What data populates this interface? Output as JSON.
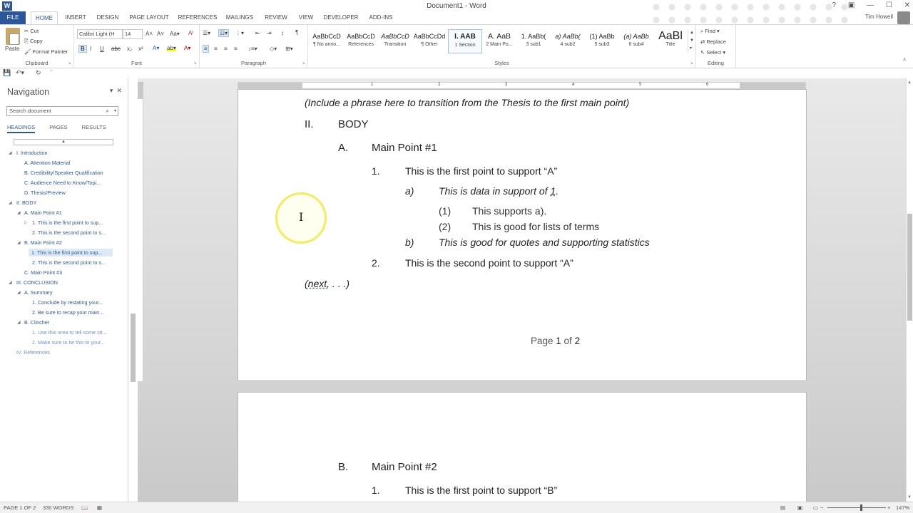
{
  "window": {
    "title": "Document1 - Word",
    "app_icon": "W",
    "user": "Tim Howell"
  },
  "tabs": [
    "FILE",
    "HOME",
    "INSERT",
    "DESIGN",
    "PAGE LAYOUT",
    "REFERENCES",
    "MAILINGS",
    "REVIEW",
    "VIEW",
    "DEVELOPER",
    "ADD-INS"
  ],
  "clipboard": {
    "paste": "Paste",
    "cut": "Cut",
    "copy": "Copy",
    "format_painter": "Format Painter",
    "label": "Clipboard"
  },
  "font": {
    "name": "Calibri Light (H",
    "size": "14",
    "label": "Font",
    "bold": "B",
    "italic": "I",
    "underline": "U"
  },
  "paragraph": {
    "label": "Paragraph"
  },
  "styles": {
    "label": "Styles",
    "items": [
      {
        "sample": "AaBbCcD",
        "name": "¶ No anno..."
      },
      {
        "sample": "AaBbCcD",
        "name": "References"
      },
      {
        "sample": "AaBbCcD",
        "name": "Transition"
      },
      {
        "sample": "AaBbCcDd",
        "name": "¶ Other"
      },
      {
        "sample": "I. AAB",
        "name": "1 Section"
      },
      {
        "sample": "A. AaB",
        "name": "2 Main Po..."
      },
      {
        "sample": "1. AaBb(",
        "name": "3 sub1"
      },
      {
        "sample": "a) AaBb(",
        "name": "4 sub2"
      },
      {
        "sample": "(1) AaBb",
        "name": "5 sub3"
      },
      {
        "sample": "(a) AaBb",
        "name": "6 sub4"
      },
      {
        "sample": "AaBl",
        "name": "Title"
      }
    ]
  },
  "editing": {
    "find": "Find",
    "replace": "Replace",
    "select": "Select",
    "label": "Editing"
  },
  "navigation": {
    "title": "Navigation",
    "search_placeholder": "Search document",
    "tabs": [
      "HEADINGS",
      "PAGES",
      "RESULTS"
    ],
    "headings": [
      "I. Introduction",
      "A. Attention Material",
      "B. Credibility/Speaker Qualification",
      "C. Audience Need to Know/Topi...",
      "D. Thesis/Preview",
      "II. BODY",
      "A. Main Point #1",
      "1. This is the first point to sup...",
      "2. This is the second point to s...",
      "B. Main Point #2",
      "1. This is the first point to sup...",
      "2. This is the second point to s...",
      "C. Main Point #3",
      "III. CONCLUSION",
      "A. Summary",
      "1. Conclude by restating your...",
      "2. Be sure to recap your main...",
      "B. Clincher",
      "1. Use this area to tell some str...",
      "2. Make sure to tie this to your...",
      "IV. References"
    ]
  },
  "ruler_numbers": [
    "1",
    "2",
    "3",
    "4",
    "5",
    "6"
  ],
  "document": {
    "transition": "(Include a phrase here to transition from the Thesis to the first main point)",
    "section_num": "II.",
    "section_title": "BODY",
    "mp1_letter": "A.",
    "mp1_title": "Main Point #1",
    "p1_num": "1.",
    "p1_text": "This is the first point to support “A”",
    "a_letter": "a)",
    "a_text": "This is data in support of ",
    "a_ref": "1",
    "a_end": ".",
    "s1_num": "(1)",
    "s1_text": "This supports a).",
    "s2_num": "(2)",
    "s2_text": "This is good for lists of terms",
    "b_letter": "b)",
    "b_text": "This is good for quotes and supporting statistics",
    "p2_num": "2.",
    "p2_text": "This is the second point to support “A”",
    "next_open": "(",
    "next_word": "next",
    "next_rest": ", . . .)",
    "page_prefix": "Page ",
    "page_cur": "1",
    "page_of": " of ",
    "page_total": "2",
    "mp2_letter": "B.",
    "mp2_title": "Main Point #2",
    "p3_num": "1.",
    "p3_text": "This is the first point to support “B”"
  },
  "status": {
    "page": "PAGE 1 OF 2",
    "words": "330 WORDS",
    "zoom": "147%"
  },
  "accent": "#2b579a"
}
